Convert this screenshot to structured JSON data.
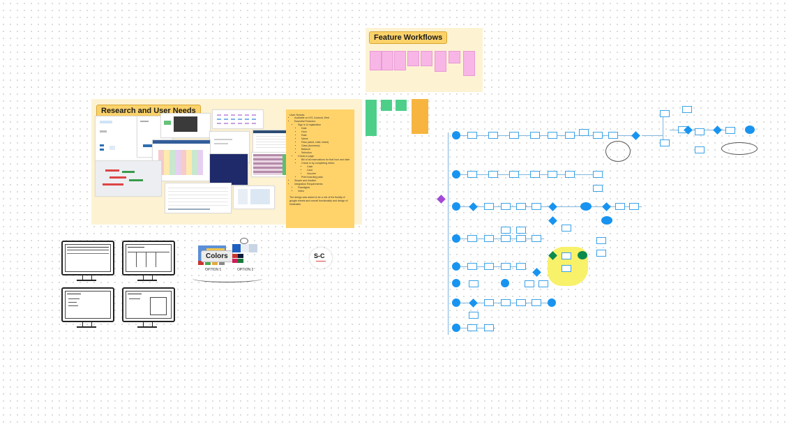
{
  "board": {
    "research_title": "Research and User Needs",
    "workflows_title": "Feature Workflows",
    "colors_title": "Colors",
    "option1": "OPTION 1",
    "option2": "OPTION 2",
    "logo_text": "S-C"
  },
  "user_needs": {
    "heading": "User Needs:",
    "items": [
      "Available on iOS, Android, Web",
      "Essential Features:",
      "Sign in & registration",
      "Date",
      "Hour",
      "Rate",
      "Name",
      "Pass (adult, child, infant)",
      "Class (business)",
      "Balance",
      "Selection",
      "Check-in page",
      "Bill of all reservations for that hour and date",
      "Check in by completing either:",
      "Cash",
      "Card",
      "Voucher",
      "Print boarding pass",
      "Simple and intuitive",
      "Integration Requirements:",
      "Flashlights",
      "Video"
    ],
    "footer": "The design was asked to be a mix of the fluidity of google sheets and overall functionality and design of Notchalter"
  },
  "colors": {
    "accent_yellow": "#fbd26a",
    "sticky_pink": "#f7b6e6",
    "sticky_green": "#4dcf8a",
    "sticky_orange": "#f7b540",
    "flow_blue": "#1894f0",
    "highlight": "#f7f05a",
    "node_green": "#0b8a4e",
    "start_purple": "#a24ad8"
  }
}
